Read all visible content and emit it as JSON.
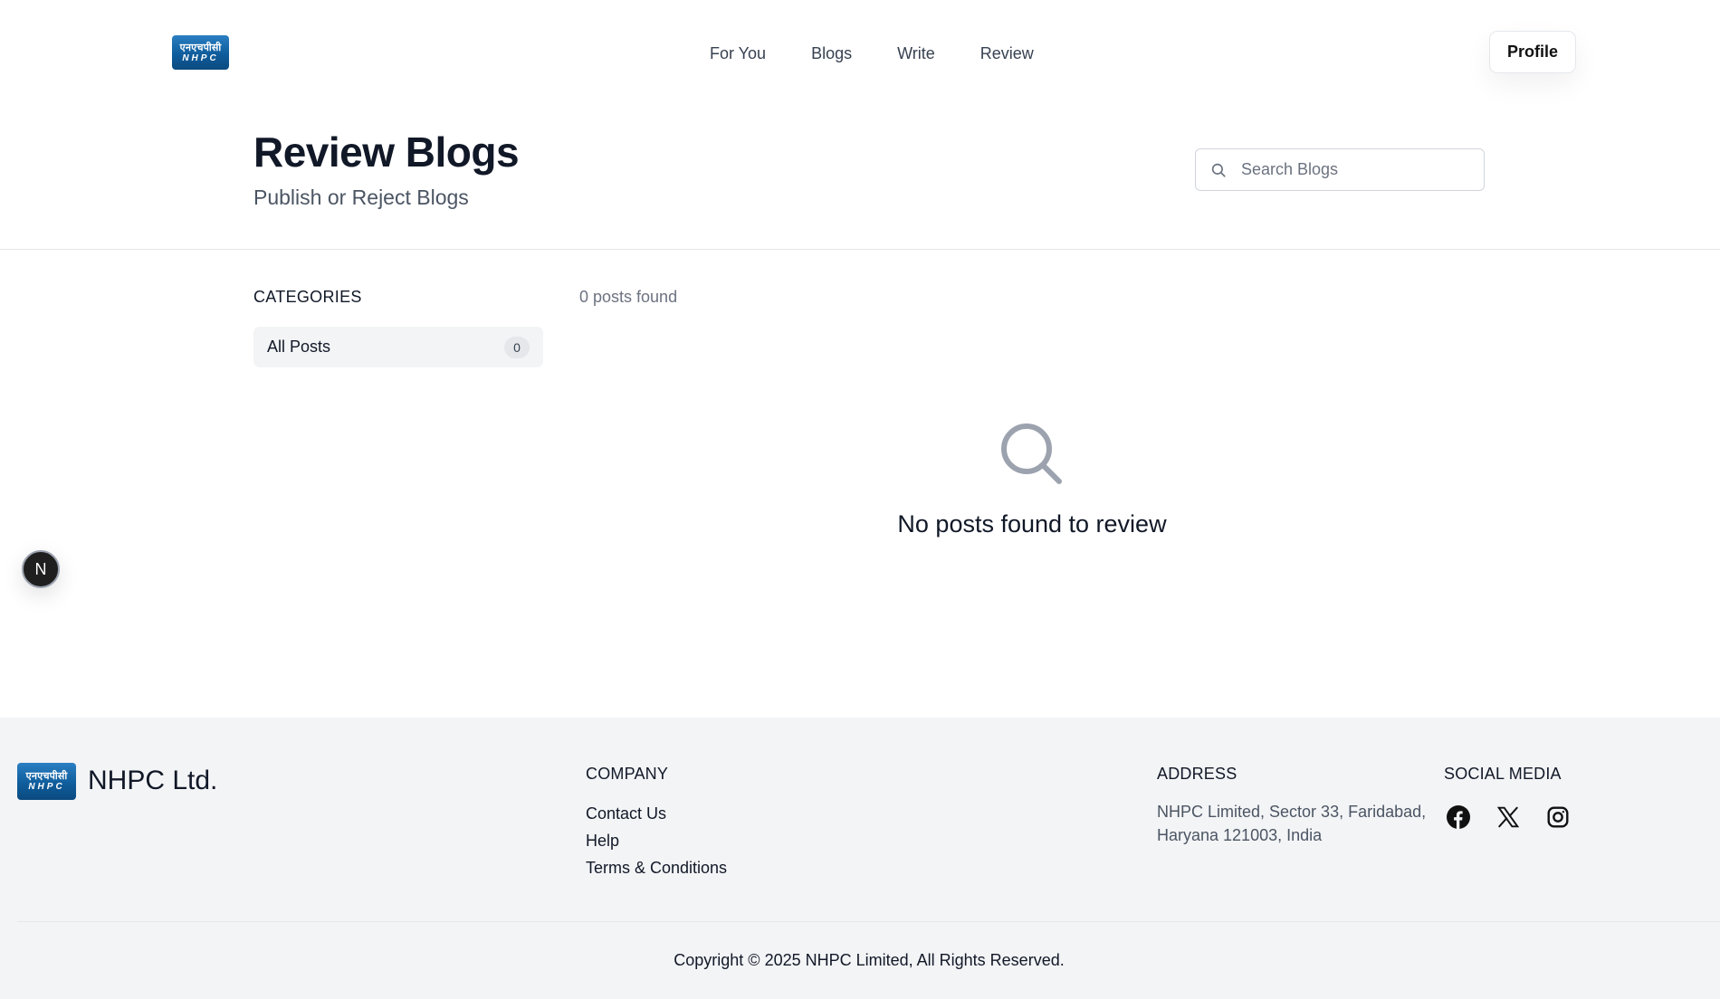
{
  "header": {
    "logo_text_top": "एनएचपीसी",
    "logo_text_bottom": "NHPC",
    "nav": [
      {
        "label": "For You"
      },
      {
        "label": "Blogs"
      },
      {
        "label": "Write"
      },
      {
        "label": "Review"
      }
    ],
    "profile_label": "Profile"
  },
  "main": {
    "title": "Review Blogs",
    "subtitle": "Publish or Reject Blogs",
    "search": {
      "placeholder": "Search Blogs",
      "value": "",
      "icon": "search-icon"
    },
    "categories_heading": "CATEGORIES",
    "categories": [
      {
        "label": "All Posts",
        "count": "0"
      }
    ],
    "posts_found": "0 posts found",
    "empty_state": {
      "icon": "search-icon",
      "message": "No posts found to review"
    }
  },
  "floating_avatar": {
    "initial": "N"
  },
  "footer": {
    "logo_text_top": "एनएचपीसी",
    "logo_text_bottom": "NHPC",
    "brand": "NHPC Ltd.",
    "company_title": "COMPANY",
    "company_links": [
      {
        "label": "Contact Us"
      },
      {
        "label": "Help"
      },
      {
        "label": "Terms & Conditions"
      }
    ],
    "address_title": "ADDRESS",
    "address_text": "NHPC Limited, Sector 33, Faridabad, Haryana 121003, India",
    "social_title": "SOCIAL MEDIA",
    "social": [
      {
        "icon": "facebook-icon"
      },
      {
        "icon": "x-twitter-icon"
      },
      {
        "icon": "instagram-icon"
      }
    ],
    "copyright": "Copyright © 2025 NHPC Limited, All Rights Reserved."
  },
  "colors": {
    "title": "#111827",
    "muted": "#6b7280",
    "footer_bg": "#f3f4f6",
    "logo_blue": "#0f5d9c",
    "empty_icon": "#9ca3af"
  }
}
